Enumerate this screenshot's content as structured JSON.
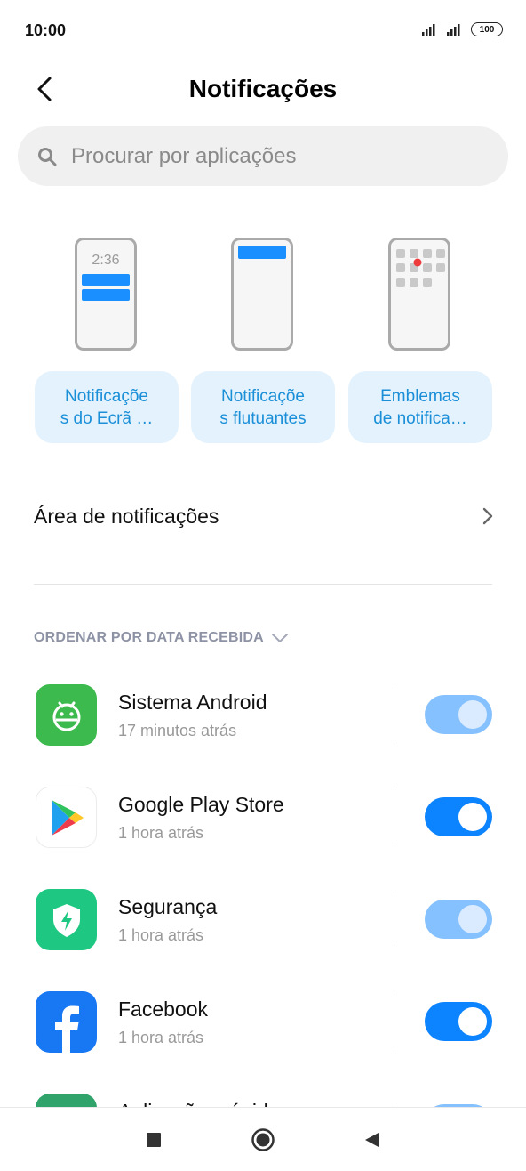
{
  "status": {
    "time": "10:00",
    "battery": "100"
  },
  "header": {
    "title": "Notificações"
  },
  "search": {
    "placeholder": "Procurar por aplicações"
  },
  "styles": [
    {
      "label": "Notificações do Ecrã …",
      "line1": "Notificaçõe",
      "line2": "s do Ecrã …",
      "preview_time": "2:36"
    },
    {
      "label": "Notificações flutuantes",
      "line1": "Notificaçõe",
      "line2": "s flutuantes"
    },
    {
      "label": "Emblemas de notificação",
      "line1": "Emblemas",
      "line2": "de notifica…"
    }
  ],
  "menu": {
    "notification_area": "Área de notificações"
  },
  "sort": {
    "label": "ORDENAR POR DATA RECEBIDA"
  },
  "apps": [
    {
      "name": "Sistema Android",
      "time": "17 minutos atrás",
      "enabled": true,
      "locked": true,
      "icon": "android-icon",
      "color": "#3dba4e"
    },
    {
      "name": "Google Play Store",
      "time": "1 hora atrás",
      "enabled": true,
      "locked": false,
      "icon": "play-store-icon",
      "color": "#ffffff"
    },
    {
      "name": "Segurança",
      "time": "1 hora atrás",
      "enabled": true,
      "locked": true,
      "icon": "security-shield-icon",
      "color": "#1ec882"
    },
    {
      "name": "Facebook",
      "time": "1 hora atrás",
      "enabled": true,
      "locked": false,
      "icon": "facebook-icon",
      "color": "#1877f2"
    },
    {
      "name": "Aplicações rápidas",
      "time": "",
      "enabled": true,
      "locked": true,
      "icon": "app-icon",
      "color": "#2fa36a"
    }
  ],
  "colors": {
    "accent": "#0d84ff",
    "toggle_on": "#0d84ff",
    "card_bg": "#e3f2fd",
    "card_text": "#1a8fd8"
  }
}
